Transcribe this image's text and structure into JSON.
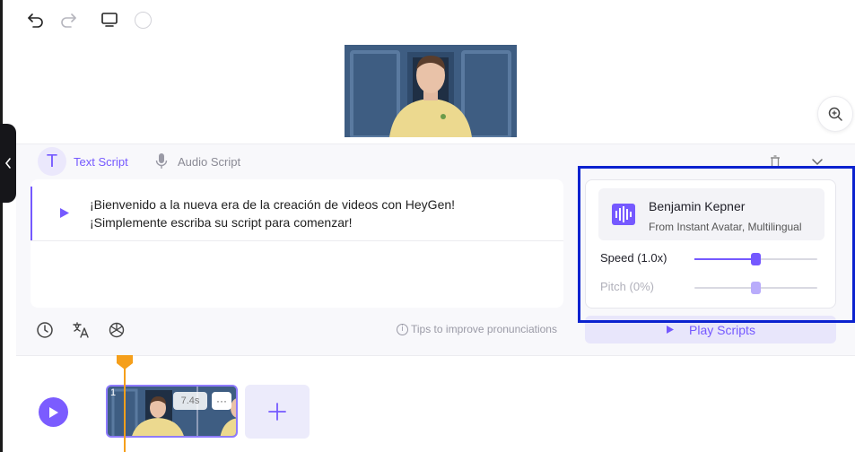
{
  "toolbar": {
    "undo_icon": "undo-icon",
    "redo_icon": "redo-icon",
    "monitor_icon": "monitor-icon",
    "background_icon": "color-circle-icon"
  },
  "script": {
    "tabs": [
      {
        "label": "Text Script",
        "icon": "T",
        "active": true
      },
      {
        "label": "Audio Script",
        "icon": "microphone-icon",
        "active": false
      }
    ],
    "lines": [
      "¡Bienvenido a la nueva era de la creación de videos con HeyGen!",
      "¡Simplemente escriba su script para comenzar!"
    ],
    "tips": "Tips to improve pronunciations",
    "play_button": "Play Scripts"
  },
  "voice": {
    "name": "Benjamin Kepner",
    "source": "From Instant Avatar, Multilingual",
    "speed_label": "Speed (1.0x)",
    "speed_fraction": 0.5,
    "pitch_label": "Pitch (0%)",
    "pitch_fraction": 0.5
  },
  "timeline": {
    "scene_number": "1",
    "duration": "7.4s",
    "more": "···",
    "add": "+"
  },
  "colors": {
    "accent": "#7559ff",
    "highlight_box": "#0b22cf",
    "playhead": "#f59f1b"
  }
}
